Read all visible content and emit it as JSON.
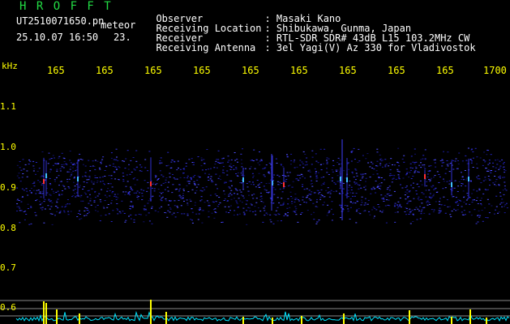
{
  "header": {
    "app_name": "H R O F F T",
    "filename": "UT2510071650.pn",
    "meteor_label": "meteor",
    "datetime": "25.10.07 16:50",
    "count": "23."
  },
  "info": [
    {
      "label": "Observer",
      "value": ": Masaki Kano"
    },
    {
      "label": "Receiving Location",
      "value": ": Shibukawa, Gunma, Japan"
    },
    {
      "label": "Receiver",
      "value": ": RTL-SDR SDR# 43dB L15 103.2MHz CW"
    },
    {
      "label": "Receiving Antenna",
      "value": ": 3el Yagi(V) Az 330 for Vladivostok"
    }
  ],
  "axes": {
    "y_unit": "kHz",
    "y_ticks": [
      "1.1",
      "1.0",
      "0.9",
      "0.8",
      "0.7",
      "0.6"
    ],
    "x_ticks": [
      "165",
      "165",
      "165",
      "165",
      "165",
      "165",
      "165",
      "165",
      "165",
      "1700"
    ]
  },
  "colors": {
    "background": "#000000",
    "title": "#22dd44",
    "text": "#ffffff",
    "axis_labels": "#ffff00",
    "spectrum_noise": "#1a1aa0",
    "echo_hot": "#ff3030",
    "baseline": "#00e5ff",
    "baseline_peaks": "#ffff00"
  }
}
